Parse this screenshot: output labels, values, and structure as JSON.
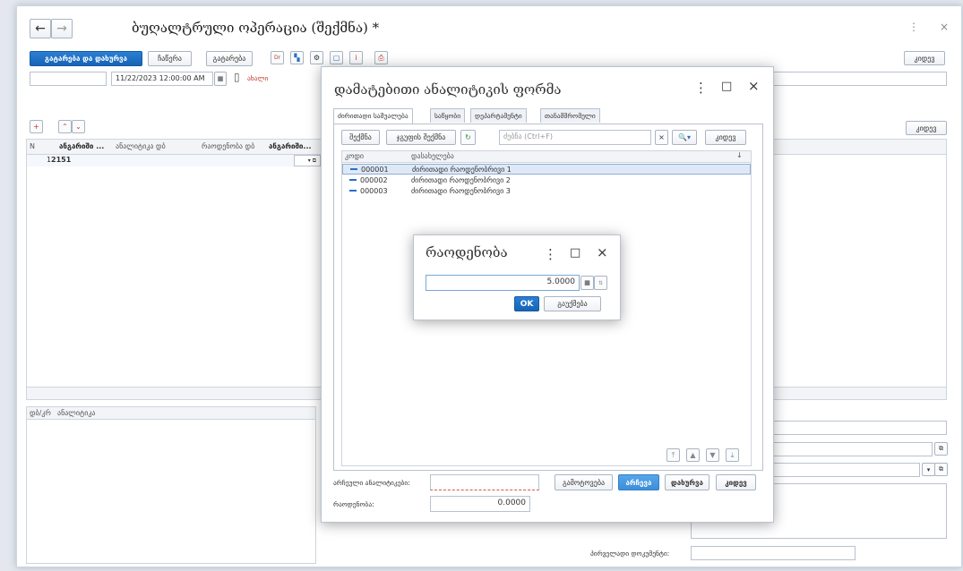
{
  "main_window": {
    "title": "ბუღალტრული ოპერაცია (შექმნა) *",
    "toolbar": {
      "post_and_close": "გატარება და დახურვა",
      "record": "ჩაწერა",
      "post": "გატარება",
      "dr_cr_label": "Dr Cr",
      "more": "კიდევ"
    },
    "date_value": "11/22/2023 12:00:00 AM",
    "new_label": "ახალი",
    "more2": "კიდევ",
    "grid": {
      "columns": [
        "N",
        "ანგარიში ...",
        "ანალიტიკა დბ",
        "რაოდენობა დბ",
        "ანგარიში..."
      ],
      "rows": [
        {
          "n": "1",
          "account": "2151"
        }
      ]
    },
    "bottom_grid": {
      "columns": [
        "დბ/კრ",
        "ანალიტიკა"
      ]
    },
    "primary_doc_label": "პირველადი დოკუმენტი:"
  },
  "analytics_dialog": {
    "title": "დამატებითი ანალიტიკის ფორმა",
    "tabs": [
      "ძირითადი საშუალება",
      "საწყობი",
      "დეპარტამენტი",
      "თანამშრომელი"
    ],
    "toolbar": {
      "create": "შექმნა",
      "create_group": "ჯგუფის შექმნა",
      "search_placeholder": "ძებნა (Ctrl+F)",
      "more": "კიდევ"
    },
    "columns": [
      "კოდი",
      "დასახელება"
    ],
    "rows": [
      {
        "code": "000001",
        "name": "ძირითადი რაოდენობრივი 1"
      },
      {
        "code": "000002",
        "name": "ძირითადი რაოდენობრივი 2"
      },
      {
        "code": "000003",
        "name": "ძირითადი რაოდენობრივი 3"
      }
    ],
    "selected_label": "არჩეული ანალიტიკები:",
    "quantity_label": "რაოდენობა:",
    "quantity_value": "0.0000",
    "buttons": {
      "exclude": "გამოტოვება",
      "choose": "არჩევა",
      "close": "დახურვა",
      "more": "კიდევ"
    }
  },
  "quantity_dialog": {
    "title": "რაოდენობა",
    "value": "5.0000",
    "ok": "OK",
    "cancel": "გაუქმება"
  }
}
